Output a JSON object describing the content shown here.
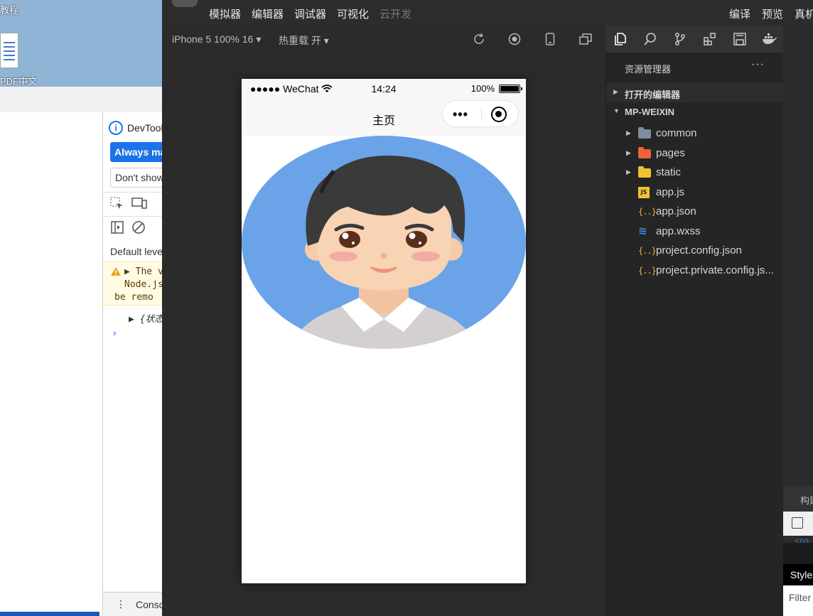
{
  "desktop": {
    "top_label": "教程",
    "icon_label": "PDF中文"
  },
  "devtools": {
    "info_text": "DevTools",
    "always_button": "Always match Chrome's language",
    "dont_show_button": "Don't show again",
    "levels_label": "Default levels",
    "warning": {
      "line1": "The v",
      "line2": "Node.js",
      "line3": "be remo"
    },
    "object_preview": "{状态",
    "prompt": "›",
    "bottom_label": "Console"
  },
  "ide": {
    "menu_items": [
      "模拟器",
      "编辑器",
      "调试器",
      "可视化"
    ],
    "menu_disabled": "云开发",
    "menu_right": [
      "编译",
      "预览",
      "真机"
    ],
    "device_label": "iPhone 5 100% 16 ▾",
    "hot_reload_label": "热重载 开 ▾"
  },
  "phone": {
    "carrier": "●●●●● WeChat",
    "time": "14:24",
    "battery_percent": "100%",
    "battery_level": 1.0,
    "nav_title": "主页",
    "capsule_dots": "•••"
  },
  "explorer": {
    "header": "资源管理器",
    "more": "···",
    "open_editors": "打开的编辑器",
    "project": "MP-WEIXIN",
    "tree": [
      {
        "name": "common",
        "type": "folder",
        "color": "#7d8d9e",
        "expandable": true
      },
      {
        "name": "pages",
        "type": "folder",
        "color": "#f0623a",
        "expandable": true
      },
      {
        "name": "static",
        "type": "folder",
        "color": "#f1c232",
        "expandable": true
      },
      {
        "name": "app.js",
        "type": "js",
        "expandable": false
      },
      {
        "name": "app.json",
        "type": "json",
        "expandable": false
      },
      {
        "name": "app.wxss",
        "type": "css",
        "expandable": false
      },
      {
        "name": "project.config.json",
        "type": "json",
        "expandable": false
      },
      {
        "name": "project.private.config.js...",
        "type": "json",
        "expandable": false
      }
    ]
  },
  "right_panel": {
    "tab": "构建",
    "tag": "<pa",
    "styles": "Styles",
    "filter": "Filter"
  },
  "colors": {
    "accent_blue": "#1a73e8",
    "avatar_bg": "#6aa3e8",
    "ide_bg": "#2b2b2b",
    "explorer_bg": "#252526"
  }
}
